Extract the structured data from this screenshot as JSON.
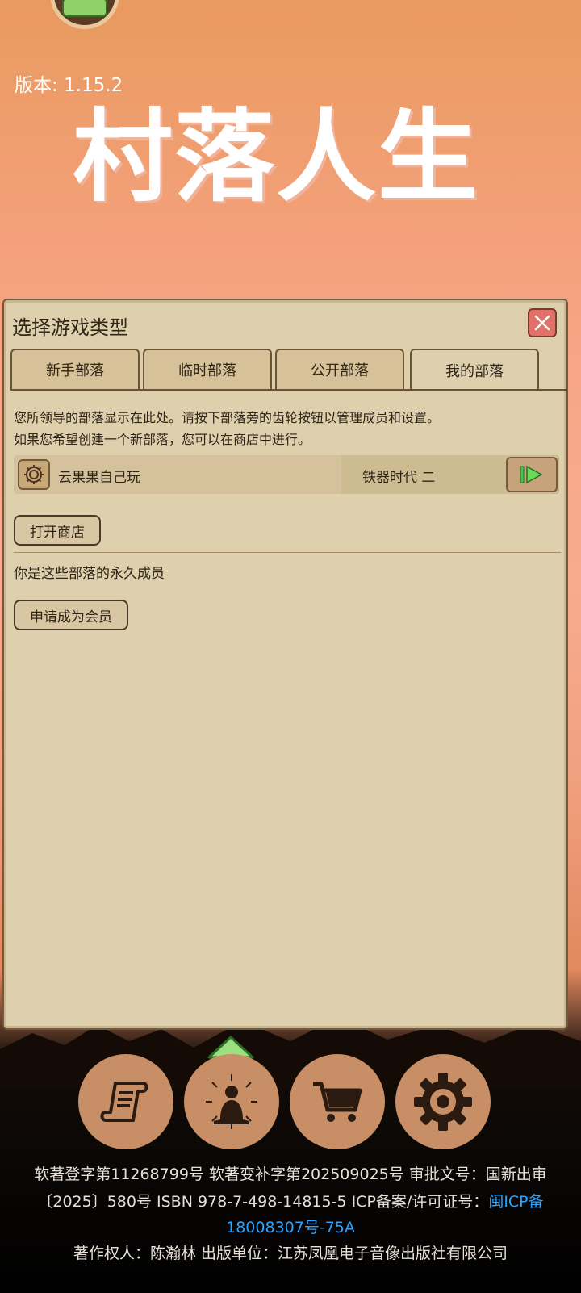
{
  "header": {
    "version_text": "版本: 1.15.2",
    "logo_text": "村落人生"
  },
  "panel": {
    "title": "选择游戏类型",
    "tabs": [
      {
        "label": "新手部落",
        "active": false
      },
      {
        "label": "临时部落",
        "active": false
      },
      {
        "label": "公开部落",
        "active": false
      },
      {
        "label": "我的部落",
        "active": true
      }
    ],
    "description_line1": "您所领导的部落显示在此处。请按下部落旁的齿轮按钮以管理成员和设置。",
    "description_line2": "如果您希望创建一个新部落，您可以在商店中进行。",
    "tribe": {
      "name": "云果果自己玩",
      "era": "铁器时代 二"
    },
    "open_shop_label": "打开商店",
    "member_text": "你是这些部落的永久成员",
    "apply_member_label": "申请成为会员"
  },
  "bottom_nav": {
    "items": [
      "scroll-icon",
      "meditate-icon",
      "cart-icon",
      "settings-icon"
    ]
  },
  "legal": {
    "line1": "软著登字第11268799号 软著变补字第202509025号 审批文号：国新出审",
    "line2_prefix": "〔2025〕580号 ISBN 978-7-498-14815-5 ICP备案/许可证号：",
    "line2_link": "闽ICP备",
    "line3_link": "18008307号-75A",
    "line4": "著作权人：陈瀚林 出版单位：江苏凤凰电子音像出版社有限公司"
  },
  "colors": {
    "panel_bg": "#decfad",
    "close_red": "#e07068",
    "round_btn": "#c88e66",
    "link_blue": "#2aa3ff"
  }
}
